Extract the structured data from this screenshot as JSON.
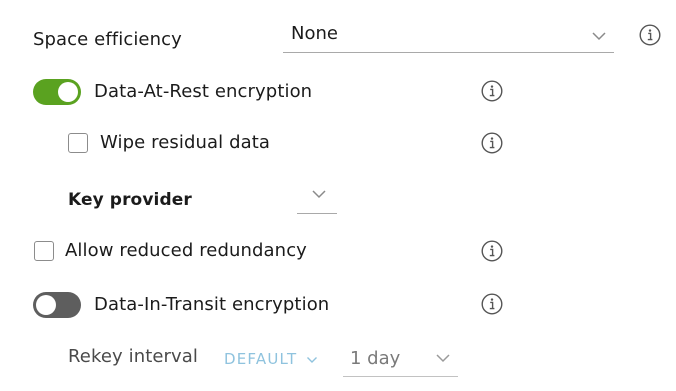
{
  "space_efficiency": {
    "label": "Space efficiency",
    "value": "None",
    "icons": {
      "dropdown": "chevron-down-icon",
      "info": "info-circle-icon"
    }
  },
  "data_at_rest": {
    "label": "Data-At-Rest encryption",
    "enabled": true,
    "wipe_residual": {
      "label": "Wipe residual data",
      "checked": false
    },
    "key_provider": {
      "label": "Key provider",
      "value": ""
    }
  },
  "allow_reduced_redundancy": {
    "label": "Allow reduced redundancy",
    "checked": false
  },
  "data_in_transit": {
    "label": "Data-In-Transit encryption",
    "enabled": false,
    "rekey_interval": {
      "label": "Rekey interval",
      "default_link": "DEFAULT",
      "value": "1 day"
    }
  },
  "colors": {
    "toggle_on": "#5aa220",
    "toggle_off": "#5e5e5e",
    "default_link": "#8fc3de",
    "underline": "#a9a9a9"
  }
}
